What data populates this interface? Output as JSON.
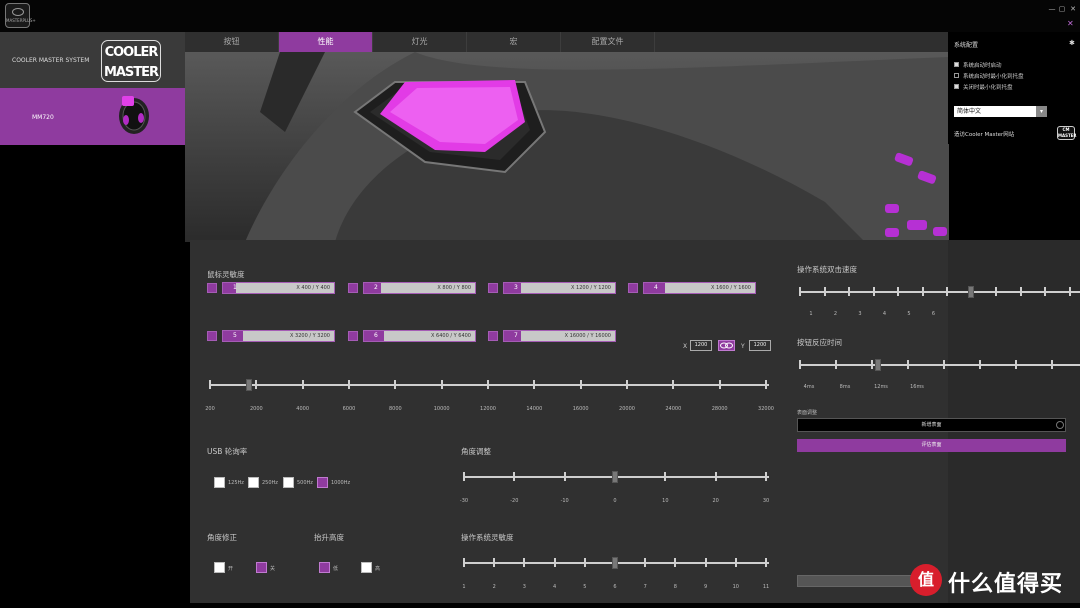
{
  "app": {
    "logo_text": "MASTERPLUS+"
  },
  "window_controls": [
    "—",
    "▢",
    "✕"
  ],
  "pin_icon": "✕",
  "devices": [
    {
      "label": "COOLER MASTER SYSTEM",
      "logo": "COOLER MASTER"
    },
    {
      "label": "MM720"
    }
  ],
  "tabs": [
    "按钮",
    "性能",
    "灯光",
    "宏",
    "配置文件"
  ],
  "active_tab": 1,
  "dpi": {
    "title": "鼠标灵敏度",
    "stages": [
      {
        "num": "1",
        "value": "X 400 / Y 400",
        "fill": 0.12
      },
      {
        "num": "2",
        "value": "X 800 / Y 800",
        "fill": 0.15
      },
      {
        "num": "3",
        "value": "X 1200 / Y 1200",
        "fill": 0.15
      },
      {
        "num": "4",
        "value": "X 1600 / Y 1600",
        "fill": 0.19
      },
      {
        "num": "5",
        "value": "X 3200 / Y 3200",
        "fill": 0.18
      },
      {
        "num": "6",
        "value": "X 6400 / Y 6400",
        "fill": 0.18
      },
      {
        "num": "7",
        "value": "X 16000 / Y 16000",
        "fill": 0.15
      }
    ],
    "x_label": "X",
    "x_value": "1200",
    "y_label": "Y",
    "y_value": "1200",
    "slider_ticks": [
      "200",
      "2000",
      "4000",
      "6000",
      "8000",
      "10000",
      "12000",
      "14000",
      "16000",
      "20000",
      "24000",
      "28000",
      "32000"
    ],
    "slider_value_index": 0.85
  },
  "usb_rate": {
    "title": "USB 轮询率",
    "options": [
      "125Hz",
      "250Hz",
      "500Hz",
      "1000Hz"
    ],
    "selected": 3
  },
  "angle_adjust": {
    "title": "角度调整",
    "ticks": [
      "-30",
      "-20",
      "-10",
      "0",
      "10",
      "20",
      "30"
    ],
    "value_index": 3
  },
  "angle_snap": {
    "title": "角度修正",
    "options": [
      "开",
      "关"
    ],
    "selected": 1
  },
  "lift_height": {
    "title": "抬升高度",
    "options": [
      "低",
      "高"
    ],
    "selected": 0
  },
  "os_sensitivity": {
    "title": "操作系统灵敏度",
    "ticks": [
      "1",
      "2",
      "3",
      "4",
      "5",
      "6",
      "7",
      "8",
      "9",
      "10",
      "11"
    ],
    "value_index": 5
  },
  "double_click": {
    "title": "操作系统双击速度",
    "ticks": [
      "1",
      "2",
      "3",
      "4",
      "5",
      "6"
    ],
    "value_index": 6
  },
  "debounce": {
    "title": "按钮反应时间",
    "ticks": [
      "4ms",
      "8ms",
      "12ms",
      "16ms"
    ],
    "value_index": 2
  },
  "surface": {
    "title": "表面调整",
    "new_label": "新增表面",
    "manage_label": "评估表面"
  },
  "system": {
    "title": "系统配置",
    "options": [
      {
        "label": "系统启动时启动",
        "on": true
      },
      {
        "label": "系统启动时最小化到托盘",
        "on": false
      },
      {
        "label": "关闭时最小化到托盘",
        "on": true
      }
    ],
    "language": "简体中文",
    "visit_label": "造访Cooler Master网站"
  },
  "watermark": {
    "icon": "值",
    "text": "什么值得买"
  },
  "colors": {
    "accent": "#8f3b9f",
    "panel": "#303030",
    "background": "#000000"
  }
}
